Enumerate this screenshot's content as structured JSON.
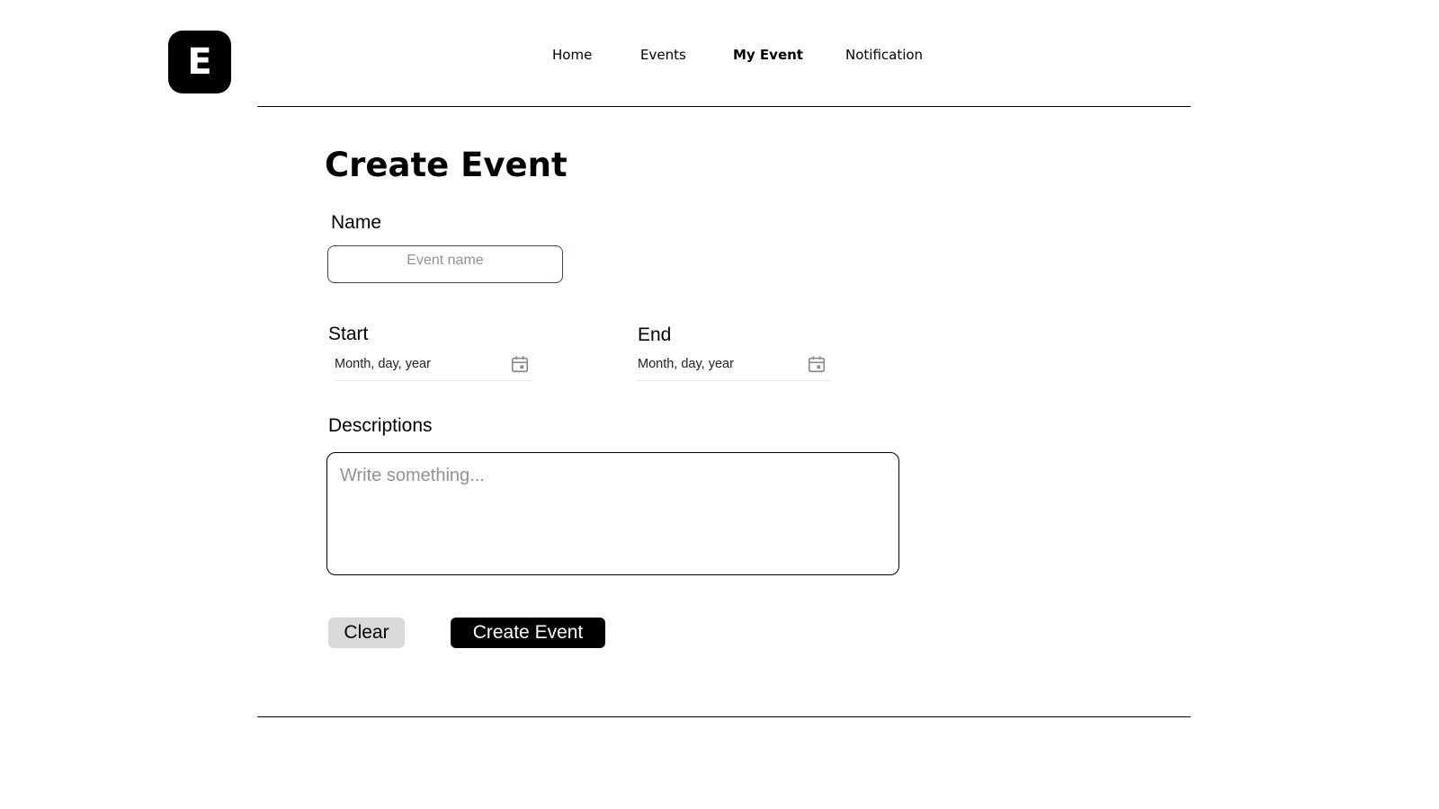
{
  "header": {
    "logo_letter": "E",
    "nav": [
      {
        "label": "Home",
        "active": false
      },
      {
        "label": "Events",
        "active": false
      },
      {
        "label": "My Event",
        "active": true
      },
      {
        "label": "Notification",
        "active": false
      }
    ]
  },
  "form": {
    "title": "Create Event",
    "name": {
      "label": "Name",
      "placeholder": "Event name",
      "value": ""
    },
    "start": {
      "label": "Start",
      "placeholder": "Month, day, year",
      "value": ""
    },
    "end": {
      "label": "End",
      "placeholder": "Month, day, year",
      "value": ""
    },
    "description": {
      "label": "Descriptions",
      "placeholder": "Write something...",
      "value": ""
    },
    "buttons": {
      "clear": "Clear",
      "create": "Create Event"
    }
  },
  "icons": {
    "date_picker": "calendar-icon"
  },
  "colors": {
    "primary": "#000000",
    "secondary_button": "#d9d9d9",
    "placeholder": "#9a9090",
    "input_border": "#3b4556",
    "icon": "#8a8a8a"
  }
}
